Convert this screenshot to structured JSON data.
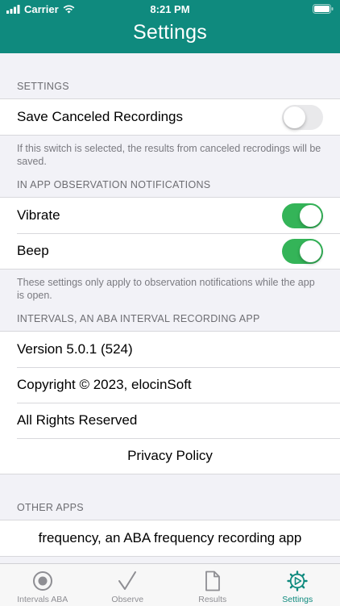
{
  "status": {
    "carrier": "Carrier",
    "time": "8:21 PM"
  },
  "nav": {
    "title": "Settings"
  },
  "sections": {
    "settings": {
      "header": "SETTINGS",
      "save_canceled_label": "Save Canceled Recordings",
      "save_canceled_on": false,
      "footer": "If this switch is selected, the results from canceled recrodings will be saved."
    },
    "notifications": {
      "header": "IN APP OBSERVATION NOTIFICATIONS",
      "vibrate_label": "Vibrate",
      "vibrate_on": true,
      "beep_label": "Beep",
      "beep_on": true,
      "footer": "These settings only apply to observation notifications while the app is open."
    },
    "about": {
      "header": "INTERVALS, AN ABA INTERVAL RECORDING APP",
      "version": "Version 5.0.1 (524)",
      "copyright": "Copyright © 2023, elocinSoft",
      "rights": "All Rights Reserved",
      "privacy": "Privacy Policy"
    },
    "other_apps": {
      "header": "OTHER APPS",
      "frequency": "frequency, an ABA frequency recording app"
    }
  },
  "tabs": [
    {
      "label": "Intervals ABA",
      "icon": "record-circle-icon"
    },
    {
      "label": "Observe",
      "icon": "checkmark-icon"
    },
    {
      "label": "Results",
      "icon": "document-icon"
    },
    {
      "label": "Settings",
      "icon": "gear-play-icon",
      "active": true
    }
  ],
  "colors": {
    "accent": "#0f8a7e",
    "switch_on": "#34b458",
    "switch_off": "#e9e9eb"
  }
}
